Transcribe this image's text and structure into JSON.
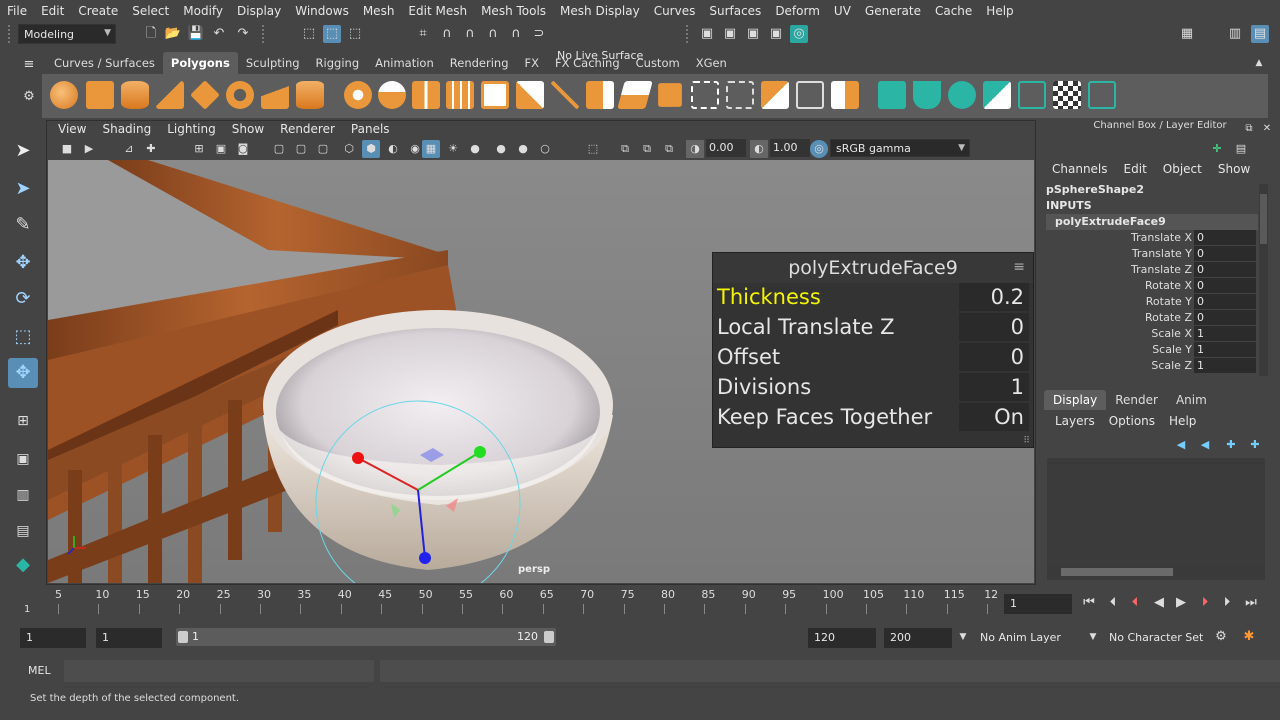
{
  "menubar": [
    "File",
    "Edit",
    "Create",
    "Select",
    "Modify",
    "Display",
    "Windows",
    "Mesh",
    "Edit Mesh",
    "Mesh Tools",
    "Mesh Display",
    "Curves",
    "Surfaces",
    "Deform",
    "UV",
    "Generate",
    "Cache",
    "Help"
  ],
  "statusline": {
    "mode": "Modeling",
    "live_surface": "No Live Surface"
  },
  "shelf_tabs": [
    "Curves / Surfaces",
    "Polygons",
    "Sculpting",
    "Rigging",
    "Animation",
    "Rendering",
    "FX",
    "FX Caching",
    "Custom",
    "XGen"
  ],
  "shelf_active_tab": "Polygons",
  "viewport": {
    "menu": [
      "View",
      "Shading",
      "Lighting",
      "Show",
      "Renderer",
      "Panels"
    ],
    "exposure": "0.00",
    "gamma": "1.00",
    "color_space": "sRGB gamma",
    "camera_label": "persp"
  },
  "inview_editor": {
    "title": "polyExtrudeFace9",
    "rows": [
      {
        "label": "Thickness",
        "value": "0.2"
      },
      {
        "label": "Local Translate Z",
        "value": "0"
      },
      {
        "label": "Offset",
        "value": "0"
      },
      {
        "label": "Divisions",
        "value": "1"
      },
      {
        "label": "Keep Faces Together",
        "value": "On"
      }
    ]
  },
  "channel_box": {
    "title": "Channel Box / Layer Editor",
    "menu": [
      "Channels",
      "Edit",
      "Object",
      "Show"
    ],
    "shape": "pSphereShape2",
    "inputs_label": "INPUTS",
    "node": "polyExtrudeFace9",
    "attributes": [
      {
        "name": "Translate X",
        "value": "0"
      },
      {
        "name": "Translate Y",
        "value": "0"
      },
      {
        "name": "Translate Z",
        "value": "0"
      },
      {
        "name": "Rotate X",
        "value": "0"
      },
      {
        "name": "Rotate Y",
        "value": "0"
      },
      {
        "name": "Rotate Z",
        "value": "0"
      },
      {
        "name": "Scale X",
        "value": "1"
      },
      {
        "name": "Scale Y",
        "value": "1"
      },
      {
        "name": "Scale Z",
        "value": "1"
      }
    ]
  },
  "layer_editor": {
    "tabs": [
      "Display",
      "Render",
      "Anim"
    ],
    "active_tab": "Display",
    "menu": [
      "Layers",
      "Options",
      "Help"
    ]
  },
  "timeline": {
    "ticks": [
      "5",
      "10",
      "15",
      "20",
      "25",
      "30",
      "35",
      "40",
      "45",
      "50",
      "55",
      "60",
      "65",
      "70",
      "75",
      "80",
      "85",
      "90",
      "95",
      "100",
      "105",
      "110",
      "115",
      "12"
    ],
    "start_marker": "1",
    "current_frame": "1"
  },
  "range": {
    "start": "1",
    "playback_start": "1",
    "range_start": "1",
    "range_end": "120",
    "playback_end": "120",
    "end": "200",
    "anim_layer": "No Anim Layer",
    "character_set": "No Character Set"
  },
  "command_line": {
    "language": "MEL"
  },
  "help_line": "Set the depth of the selected component."
}
